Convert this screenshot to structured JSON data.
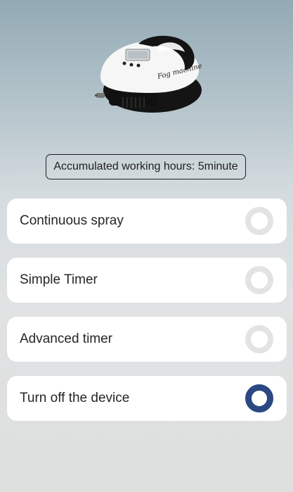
{
  "device_image": {
    "label": "Fog machine",
    "icon": "fog-machine-illustration"
  },
  "working_hours": {
    "text": "Accumulated working hours: 5minute"
  },
  "colors": {
    "accent": "#2b4882",
    "radio_off": "#e3e3e3",
    "card": "#ffffff"
  },
  "options": [
    {
      "label": "Continuous spray",
      "selected": false
    },
    {
      "label": "Simple Timer",
      "selected": false
    },
    {
      "label": "Advanced timer",
      "selected": false
    },
    {
      "label": "Turn off the device",
      "selected": true
    }
  ]
}
